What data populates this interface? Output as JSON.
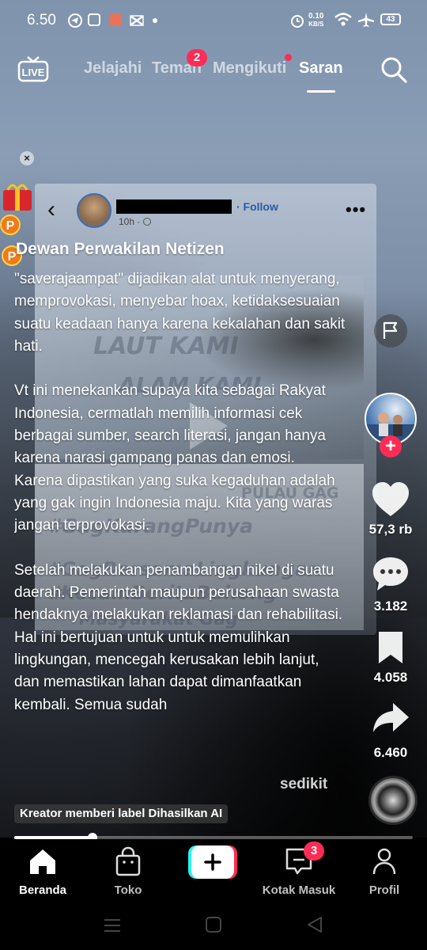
{
  "status_bar": {
    "time": "6.50",
    "net_speed_value": "0.10",
    "net_speed_unit": "KB/S",
    "battery": "43"
  },
  "top_nav": {
    "tabs": [
      {
        "label": "Jelajahi",
        "active": false
      },
      {
        "label": "Teman",
        "active": false,
        "badge": "2"
      },
      {
        "label": "Mengikuti",
        "active": false,
        "dot": true
      },
      {
        "label": "Saran",
        "active": true
      }
    ]
  },
  "video_overlay": {
    "follow_label": "· Follow",
    "post_time": "10h ·",
    "sign_texts": [
      "LAUT KAMI",
      "ALAM KAMI",
      "PULAU GAG",
      "#GagKarangPunya",
      "#GagBersamaLingkungan",
      "#KecamBeritaBohong",
      "Masyarakat Gag"
    ]
  },
  "caption": {
    "author": "Dewan Perwakilan Netizen",
    "paragraphs": [
      "\"saverajaampat\" dijadikan alat untuk menyerang, memprovokasi, menyebar hoax, ketidaksesuaian suatu keadaan hanya karena kekalahan dan sakit hati.",
      "Vt ini menekankan supaya kita sebagai Rakyat Indonesia, cermatlah memilih informasi cek berbagai sumber, search literasi, jangan hanya karena narasi gampang panas dan emosi.",
      "Karena dipastikan yang suka kegaduhan adalah yang gak ingin Indonesia maju. Kita yang waras jangan terprovokasi.",
      "Setelah melakukan penambangan nikel di suatu daerah. Pemerintah maupun perusahaan swasta hendaknya melakukan reklamasi dan rehabilitasi. Hal ini bertujuan untuk untuk memulihkan lingkungan, mencegah kerusakan lebih lanjut, dan memastikan lahan dapat dimanfaatkan kembali. Semua sudah"
    ],
    "more_label": "sedikit",
    "ai_label": "Kreator memberi label Dihasilkan AI"
  },
  "rail": {
    "likes": "57,3 rb",
    "comments": "3.182",
    "bookmarks": "4.058",
    "shares": "6.460"
  },
  "progress": {
    "fraction": 0.196
  },
  "bottom_nav": {
    "items": [
      {
        "label": "Beranda",
        "active": true
      },
      {
        "label": "Toko",
        "active": false
      },
      {
        "label": "Kotak Masuk",
        "active": false,
        "badge": "3"
      },
      {
        "label": "Profil",
        "active": false
      }
    ]
  },
  "colors": {
    "accent_red": "#fe2c55",
    "accent_cyan": "#25f4ee"
  }
}
